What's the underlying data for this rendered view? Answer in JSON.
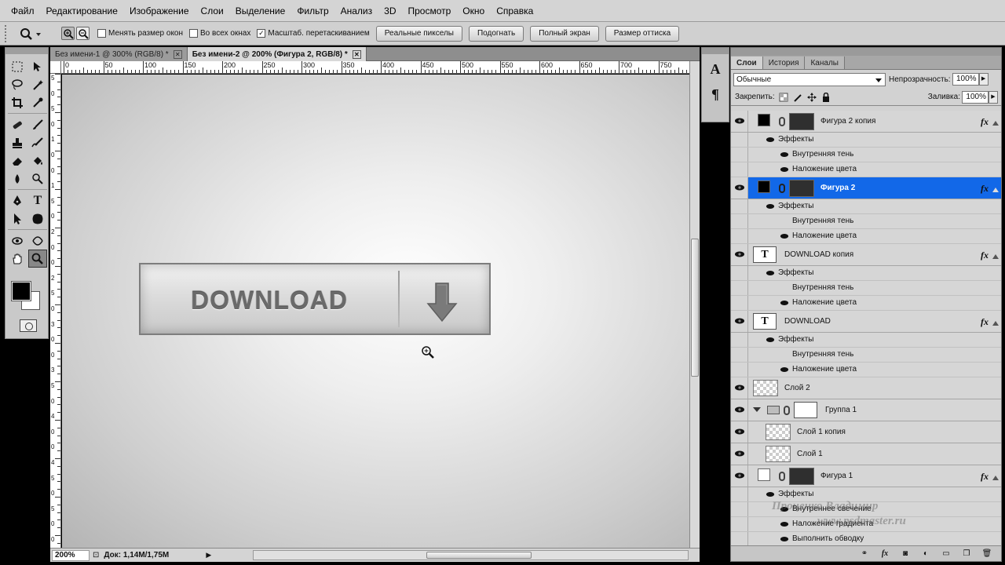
{
  "menu": [
    "Файл",
    "Редактирование",
    "Изображение",
    "Слои",
    "Выделение",
    "Фильтр",
    "Анализ",
    "3D",
    "Просмотр",
    "Окно",
    "Справка"
  ],
  "options": {
    "checkbox_resize": "Менять размер окон",
    "checkbox_all_windows": "Во всех окнах",
    "checkbox_scrubby": "Масштаб. перетаскиванием",
    "btn_actual_pixels": "Реальные пикселы",
    "btn_fit": "Подогнать",
    "btn_fullscreen": "Полный экран",
    "btn_print_size": "Размер оттиска"
  },
  "tabs": [
    {
      "label": "Без имени-1 @ 300% (RGB/8) *",
      "active": false
    },
    {
      "label": "Без имени-2 @ 200% (Фигура 2, RGB/8) *",
      "active": true
    }
  ],
  "ruler_h": [
    "0",
    "50",
    "100",
    "150",
    "200",
    "250",
    "300",
    "350",
    "400",
    "450",
    "500",
    "550",
    "600",
    "650",
    "700",
    "750",
    "800"
  ],
  "ruler_v": [
    "5",
    "0",
    "5",
    "0",
    "1",
    "0",
    "0",
    "1",
    "5",
    "0",
    "2",
    "0",
    "0",
    "2",
    "5",
    "0",
    "3",
    "0",
    "0",
    "3",
    "5",
    "0",
    "4",
    "0",
    "0",
    "4",
    "5",
    "0",
    "5",
    "0",
    "0"
  ],
  "canvas": {
    "button_text": "DOWNLOAD"
  },
  "status": {
    "zoom": "200%",
    "doc": "Док: 1,14M/1,75M"
  },
  "panel": {
    "tabs": [
      "Слои",
      "История",
      "Каналы"
    ],
    "blend_mode": "Обычные",
    "opacity_label": "Непрозрачность:",
    "opacity": "100%",
    "lock_label": "Закрепить:",
    "fill_label": "Заливка:",
    "fill": "100%"
  },
  "layers": {
    "l1": {
      "name": "Фигура 2 копия",
      "fx": "fx",
      "effects": "Эффекты",
      "e1": "Внутренняя тень",
      "e2": "Наложение цвета"
    },
    "l2": {
      "name": "Фигура 2",
      "fx": "fx",
      "effects": "Эффекты",
      "e1": "Внутренняя тень",
      "e2": "Наложение цвета"
    },
    "l3": {
      "name": "DOWNLOAD копия",
      "fx": "fx",
      "effects": "Эффекты",
      "e1": "Внутренняя тень",
      "e2": "Наложение цвета",
      "thumb": "T"
    },
    "l4": {
      "name": "DOWNLOAD",
      "fx": "fx",
      "effects": "Эффекты",
      "e1": "Внутренняя тень",
      "e2": "Наложение цвета",
      "thumb": "T"
    },
    "l5": {
      "name": "Слой 2"
    },
    "group": {
      "name": "Группа 1"
    },
    "l6": {
      "name": "Слой 1 копия"
    },
    "l7": {
      "name": "Слой 1"
    },
    "l8": {
      "name": "Фигура 1",
      "fx": "fx",
      "effects": "Эффекты",
      "e1": "Внутреннее свечение",
      "e2": "Наложение градиента",
      "e3": "Выполнить обводку"
    }
  },
  "watermark": {
    "line1": "Проценко Владимир",
    "line2": "www.psdmaster.ru"
  },
  "colors": {
    "selected_layer": "#1268e8",
    "foreground": "#000000",
    "background": "#ffffff"
  },
  "icons": [
    "zoom-icon",
    "rect-marquee-icon",
    "move-icon",
    "lasso-icon",
    "magic-wand-icon",
    "crop-icon",
    "eyedropper-icon",
    "healing-brush-icon",
    "brush-icon",
    "stamp-icon",
    "history-brush-icon",
    "eraser-icon",
    "paint-bucket-icon",
    "blur-icon",
    "dodge-icon",
    "pen-icon",
    "type-icon",
    "path-select-icon",
    "custom-shape-icon",
    "3d-rotate-icon",
    "3d-orbit-icon",
    "hand-icon",
    "zoom-tool-icon",
    "eye-icon",
    "link-icon",
    "fx-icon",
    "folder-icon",
    "trash-icon"
  ]
}
